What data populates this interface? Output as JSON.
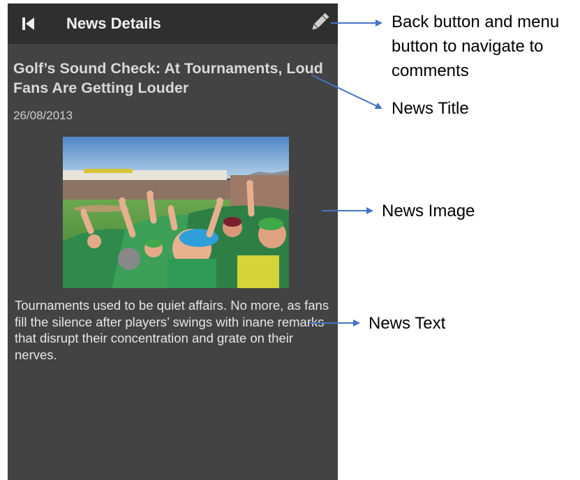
{
  "app": {
    "title": "News Details",
    "back_icon": "skip-back-icon",
    "menu_icon": "pencil-icon"
  },
  "article": {
    "title": "Golf’s Sound Check: At Tournaments, Loud Fans Are Getting Louder",
    "date": "26/08/2013",
    "image_description": "Cheering golf fans in a stadium",
    "text": "Tournaments used to be quiet affairs. No more, as fans fill the silence after players’ swings with inane remarks that disrupt their concentration and grate on their nerves."
  },
  "annotations": {
    "back_menu": [
      "Back button and menu",
      "button to navigate to",
      "comments"
    ],
    "title": "News Title",
    "image": "News Image",
    "text": "News Text"
  },
  "colors": {
    "appbar": "#2f2f2f",
    "background": "#434343",
    "annotation_arrow": "#4472c4"
  }
}
